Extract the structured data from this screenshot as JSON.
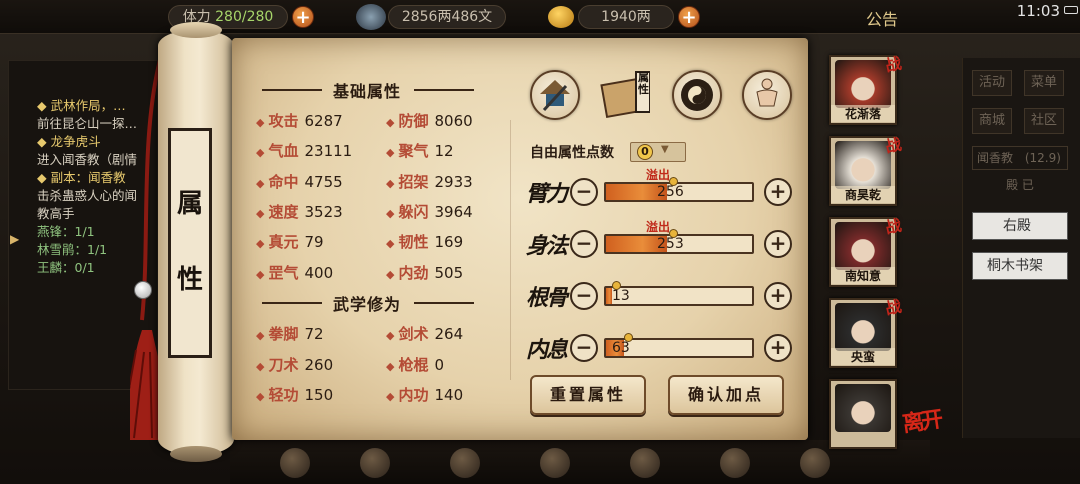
{
  "topbar": {
    "stamina_label": "体力",
    "stamina": "280/280",
    "money": "2856两486文",
    "gold": "1940两",
    "notice": "公告",
    "time": "11:03"
  },
  "quests": [
    {
      "text": "◆ 武林作局，…",
      "cls": "gold"
    },
    {
      "text": "前往昆仑山一探…",
      "cls": "white"
    },
    {
      "text": "◆ 龙争虎斗",
      "cls": "gold"
    },
    {
      "text": "进入闻香教（剧情",
      "cls": "white"
    },
    {
      "text": "◆ 副本：闻香教",
      "cls": "gold"
    },
    {
      "text": "击杀蛊惑人心的闻",
      "cls": "white"
    },
    {
      "text": "教高手",
      "cls": "white"
    },
    {
      "text": "燕锋：1/1",
      "cls": "green"
    },
    {
      "text": "林雪鹃：1/1",
      "cls": "green"
    },
    {
      "text": "王麟：0/1",
      "cls": "green"
    }
  ],
  "side_menu": {
    "activity": "活动",
    "menu": "菜单",
    "shop": "商城",
    "community": "社区",
    "location": "闻香教",
    "location_level": "(12.9)",
    "sub": "殿 已",
    "right_hall": "右殿",
    "bookshelf": "桐木书架"
  },
  "scroll_title": [
    "属",
    "性"
  ],
  "basic": {
    "title": "基础属性",
    "stats": [
      {
        "label": "攻击",
        "value": "6287"
      },
      {
        "label": "防御",
        "value": "8060"
      },
      {
        "label": "气血",
        "value": "23111"
      },
      {
        "label": "聚气",
        "value": "12"
      },
      {
        "label": "命中",
        "value": "4755"
      },
      {
        "label": "招架",
        "value": "2933"
      },
      {
        "label": "速度",
        "value": "3523"
      },
      {
        "label": "躲闪",
        "value": "3964"
      },
      {
        "label": "真元",
        "value": "79"
      },
      {
        "label": "韧性",
        "value": "169"
      },
      {
        "label": "罡气",
        "value": "400"
      },
      {
        "label": "内劲",
        "value": "505"
      }
    ]
  },
  "martial": {
    "title": "武学修为",
    "stats": [
      {
        "label": "拳脚",
        "value": "72"
      },
      {
        "label": "剑术",
        "value": "264"
      },
      {
        "label": "刀术",
        "value": "260"
      },
      {
        "label": "枪棍",
        "value": "0"
      },
      {
        "label": "轻功",
        "value": "150"
      },
      {
        "label": "内功",
        "value": "140"
      }
    ]
  },
  "tab_attr_label": "属性",
  "free_points": {
    "label": "自由属性点数",
    "value": "0"
  },
  "attributes": [
    {
      "label": "臂力",
      "value": "256",
      "fill": 0.42,
      "overflow": "溢出"
    },
    {
      "label": "身法",
      "value": "253",
      "fill": 0.42,
      "overflow": "溢出"
    },
    {
      "label": "根骨",
      "value": "13",
      "fill": 0.04,
      "overflow": ""
    },
    {
      "label": "内息",
      "value": "63",
      "fill": 0.12,
      "overflow": ""
    }
  ],
  "buttons": {
    "reset": "重置属性",
    "confirm": "确认加点"
  },
  "party": [
    {
      "name": "花渐落",
      "battle": "战",
      "color": "#a43a2a"
    },
    {
      "name": "商昊乾",
      "battle": "战",
      "color": "#e6e0d6"
    },
    {
      "name": "南知意",
      "battle": "战",
      "color": "#7a2a2a"
    },
    {
      "name": "央蛮",
      "battle": "战",
      "color": "#2b2b2b"
    },
    {
      "name": "",
      "battle": "",
      "color": "#3a3632"
    }
  ],
  "leave": "离开",
  "colors": {
    "accent_red": "#b44b35",
    "parchment": "#ecdcb9",
    "bar_fill": "#e0782c"
  }
}
